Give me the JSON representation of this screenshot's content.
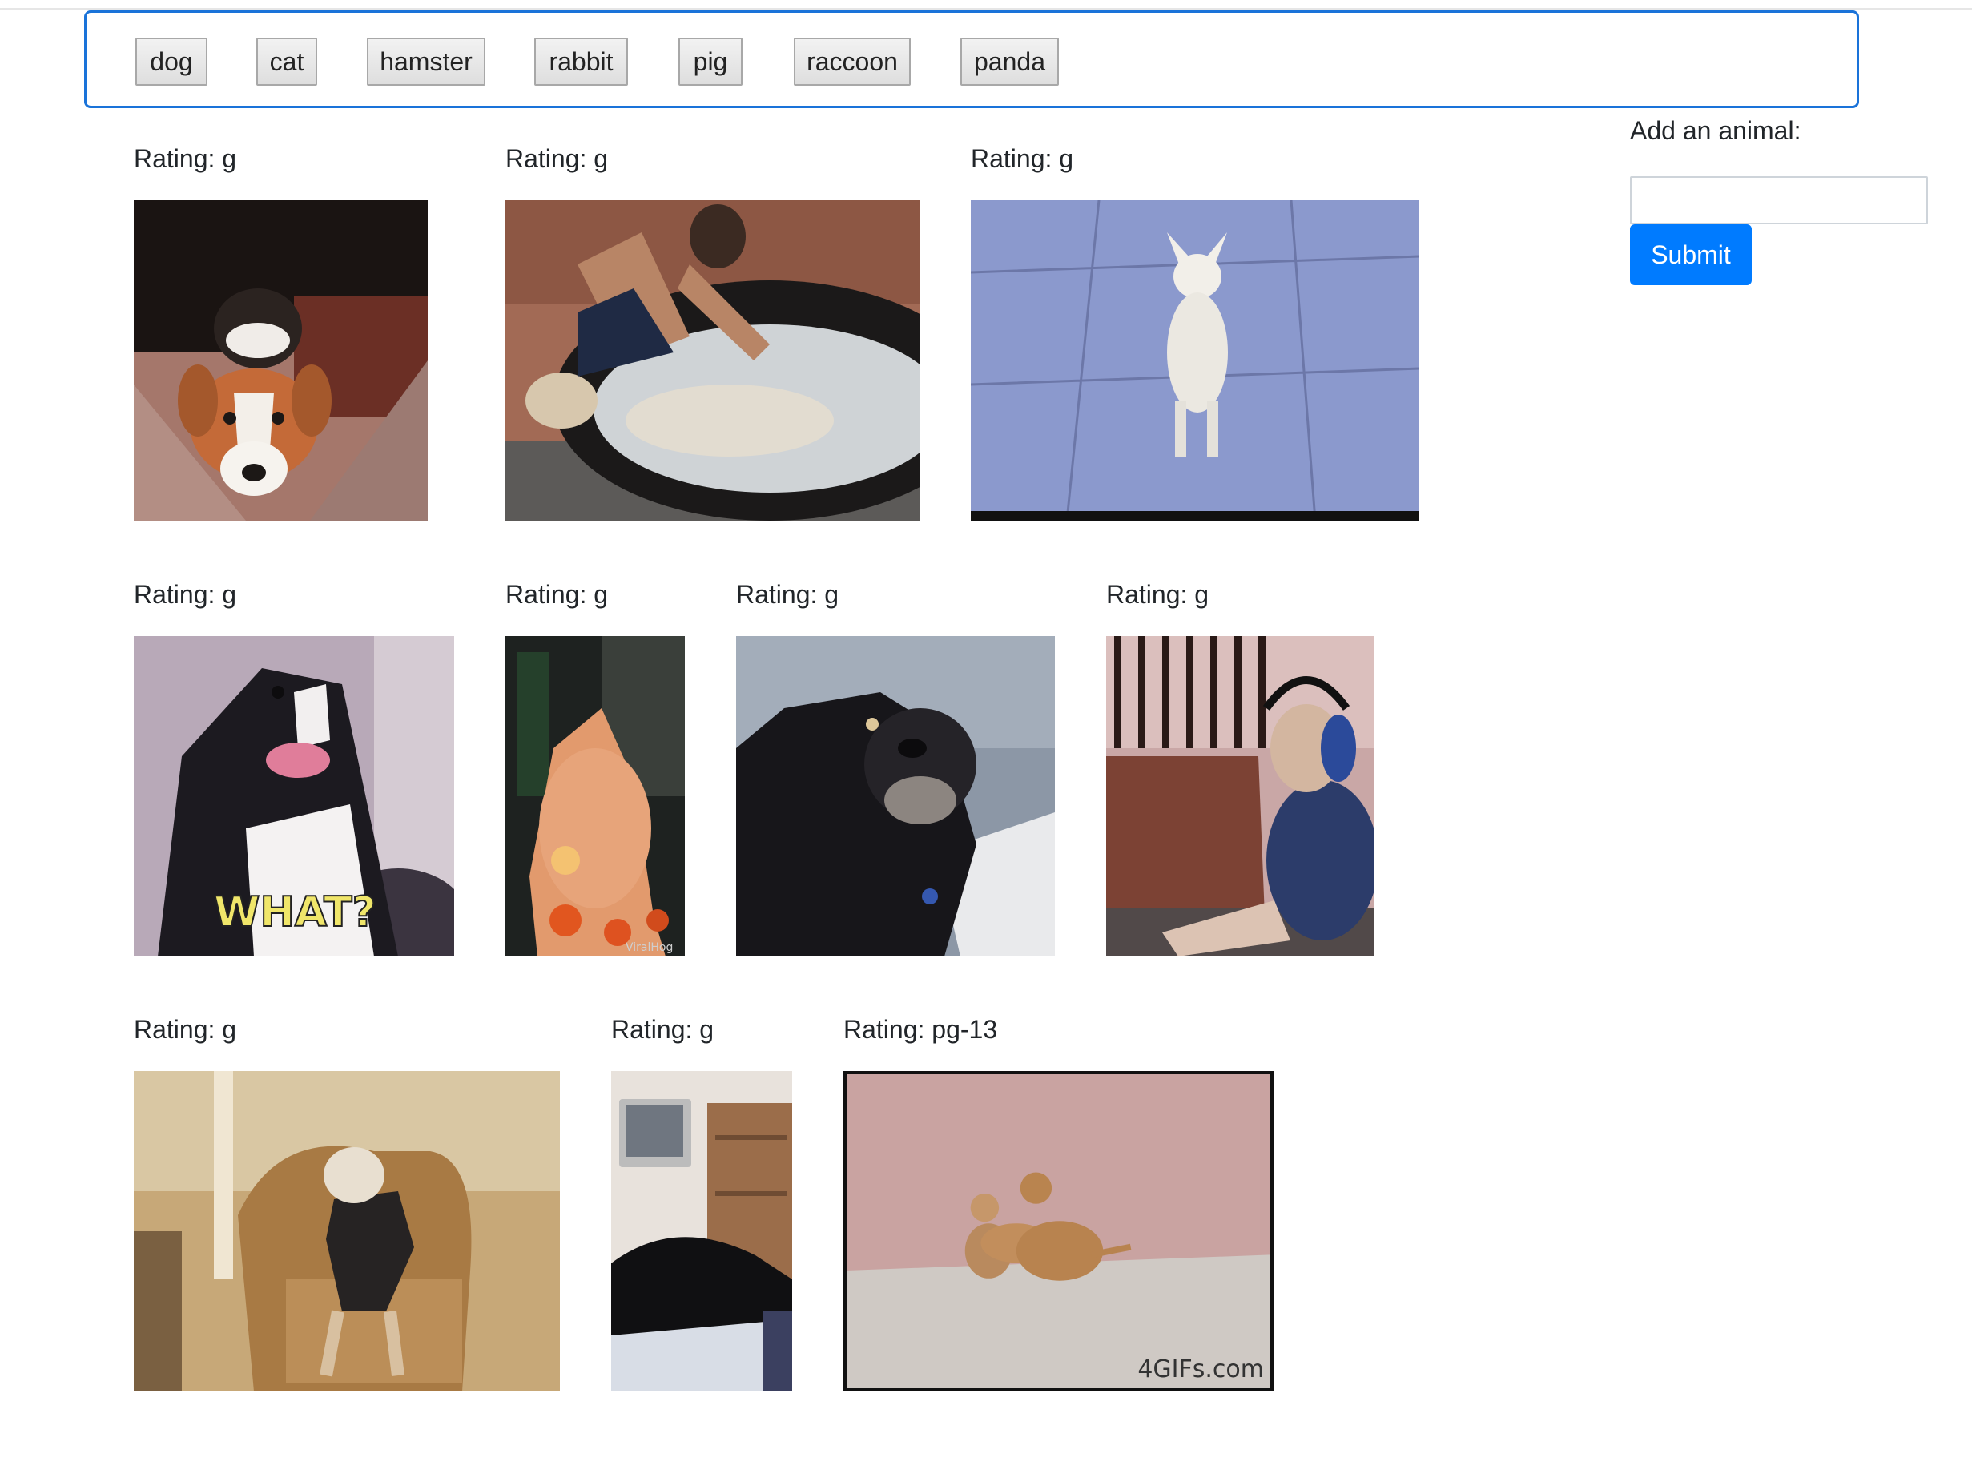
{
  "buttons": [
    {
      "label": "dog"
    },
    {
      "label": "cat"
    },
    {
      "label": "hamster"
    },
    {
      "label": "rabbit"
    },
    {
      "label": "pig"
    },
    {
      "label": "raccoon"
    },
    {
      "label": "panda"
    }
  ],
  "gifs": [
    {
      "rating": "Rating: g",
      "subject": "beagle on couch"
    },
    {
      "rating": "Rating: g",
      "subject": "man washing dog in tub"
    },
    {
      "rating": "Rating: g",
      "subject": "chihuahua standing on hind legs"
    },
    {
      "rating": "Rating: g",
      "subject": "dog reacting",
      "caption": "WHAT?"
    },
    {
      "rating": "Rating: g",
      "subject": "dog in ghost costume with pumpkins"
    },
    {
      "rating": "Rating: g",
      "subject": "black dog looking up"
    },
    {
      "rating": "Rating: g",
      "subject": "pug wearing headphones"
    },
    {
      "rating": "Rating: g",
      "subject": "cat dancing on armchair"
    },
    {
      "rating": "Rating: g",
      "subject": "black cat in living room"
    },
    {
      "rating": "Rating: pg-13",
      "subject": "two small dogs",
      "watermark": "4GIFs.com"
    }
  ],
  "sidebar": {
    "label": "Add an animal:",
    "input_value": "",
    "submit_label": "Submit"
  },
  "colors": {
    "accent": "#007bff",
    "bar_border": "#1a73d9"
  }
}
